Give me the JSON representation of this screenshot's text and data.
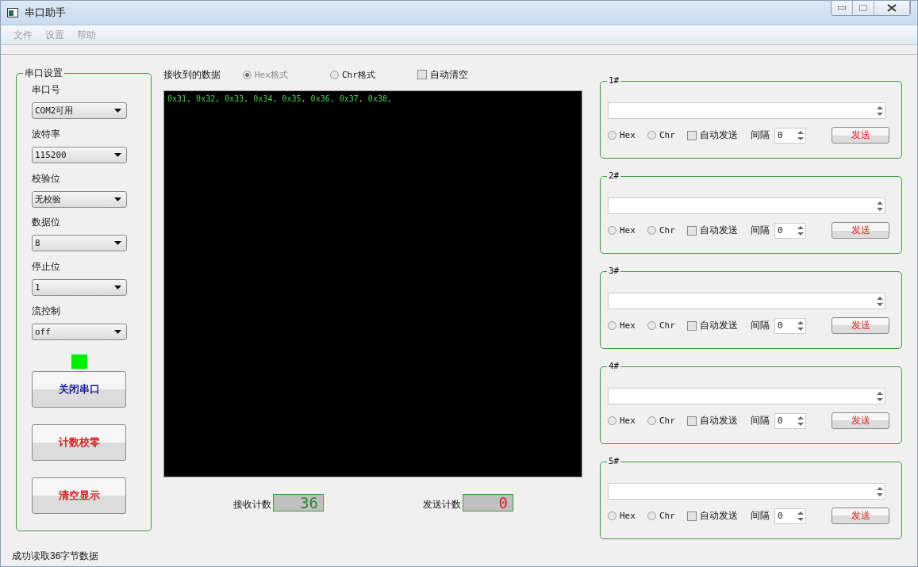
{
  "window": {
    "title": "串口助手"
  },
  "menu": [
    {
      "label": "文件",
      "disabled": true
    },
    {
      "label": "设置",
      "disabled": true
    },
    {
      "label": "帮助",
      "disabled": true
    }
  ],
  "serial_settings": {
    "title": "串口设置",
    "fields": [
      {
        "label": "串口号",
        "value": "COM2可用"
      },
      {
        "label": "波特率",
        "value": "115200"
      },
      {
        "label": "校验位",
        "value": "无校验"
      },
      {
        "label": "数据位",
        "value": "8"
      },
      {
        "label": "停止位",
        "value": "1"
      },
      {
        "label": "流控制",
        "value": "off"
      }
    ],
    "indicator": {
      "on": true
    },
    "buttons": [
      {
        "label": "关闭串口",
        "color": "#1a1aa0"
      },
      {
        "label": "计数校零",
        "color": "#d42020"
      },
      {
        "label": "清空显示",
        "color": "#d42020"
      }
    ]
  },
  "receive": {
    "title": "接收到的数据",
    "formats": [
      {
        "label": "Hex格式",
        "selected": true,
        "disabled": true
      },
      {
        "label": "Chr格式",
        "selected": false,
        "disabled": false
      }
    ],
    "auto_clear": {
      "label": "自动清空",
      "checked": false
    },
    "output": "0x31, 0x32, 0x33, 0x34, 0x35, 0x36, 0x37, 0x38,",
    "counters": [
      {
        "label": "接收计数",
        "value": "36",
        "color": "#2a8a2a"
      },
      {
        "label": "发送计数",
        "value": "0",
        "color": "#e02020"
      }
    ]
  },
  "send_groups": [
    {
      "title": "1#",
      "formats": [
        {
          "label": "Hex",
          "selected": false
        },
        {
          "label": "Chr",
          "selected": false
        }
      ],
      "auto_send": {
        "label": "自动发送",
        "checked": false
      },
      "interval_label": "间隔",
      "interval": "0",
      "button": "发送"
    },
    {
      "title": "2#",
      "formats": [
        {
          "label": "Hex",
          "selected": false
        },
        {
          "label": "Chr",
          "selected": false
        }
      ],
      "auto_send": {
        "label": "自动发送",
        "checked": false
      },
      "interval_label": "间隔",
      "interval": "0",
      "button": "发送"
    },
    {
      "title": "3#",
      "formats": [
        {
          "label": "Hex",
          "selected": false
        },
        {
          "label": "Chr",
          "selected": false
        }
      ],
      "auto_send": {
        "label": "自动发送",
        "checked": false
      },
      "interval_label": "间隔",
      "interval": "0",
      "button": "发送"
    },
    {
      "title": "4#",
      "formats": [
        {
          "label": "Hex",
          "selected": false
        },
        {
          "label": "Chr",
          "selected": false
        }
      ],
      "auto_send": {
        "label": "自动发送",
        "checked": false
      },
      "interval_label": "间隔",
      "interval": "0",
      "button": "发送"
    },
    {
      "title": "5#",
      "formats": [
        {
          "label": "Hex",
          "selected": false
        },
        {
          "label": "Chr",
          "selected": false
        }
      ],
      "auto_send": {
        "label": "自动发送",
        "checked": false
      },
      "interval_label": "间隔",
      "interval": "0",
      "button": "发送"
    }
  ],
  "status_bar": "成功读取36字节数据"
}
